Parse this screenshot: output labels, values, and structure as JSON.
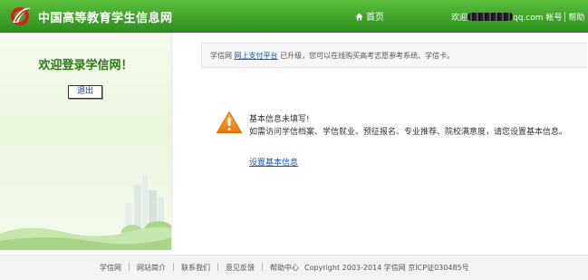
{
  "header": {
    "site_title": "中国高等教育学生信息网",
    "home_label": "首页",
    "user_prefix": "欢迎",
    "user_suffix": "qq.com",
    "account_label": "帐号",
    "help_label": "帮助"
  },
  "left": {
    "welcome": "欢迎登录学信网！",
    "logout_label": "退出"
  },
  "notice": {
    "prefix": "学信网",
    "link": "网上支付平台",
    "suffix": "已升级，您可以在线购买高考志愿参考系统、学信卡。"
  },
  "info": {
    "title": "基本信息未填写!",
    "description": "如需访问学信档案、学信就业、预征报名、专业推荐、院校满意度，请您设置基本信息。",
    "link": "设置基本信息"
  },
  "footer": {
    "links": [
      "学信网",
      "网站简介",
      "联系我们",
      "意见反馈",
      "帮助中心"
    ],
    "copyright": "Copyright 2003-2014 学信网 京ICP证030485号"
  },
  "colors": {
    "header_green": "#3fa52a",
    "welcome_green": "#2c7a0f",
    "link_blue": "#1a55b8",
    "warning_orange": "#f08a12"
  },
  "icons": {
    "logo": "chsi-logo",
    "home": "home-icon",
    "warning": "warning-icon"
  }
}
